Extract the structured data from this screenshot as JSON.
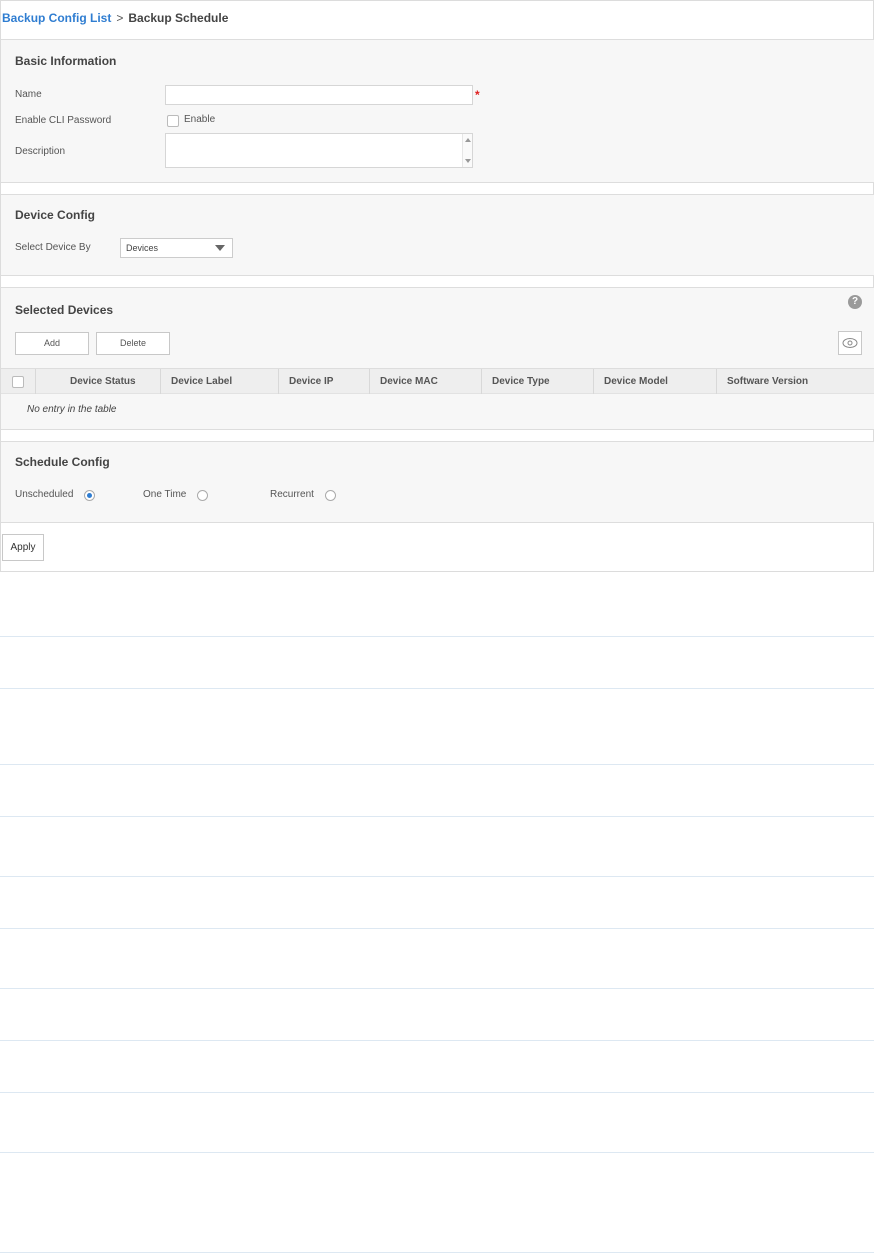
{
  "breadcrumb": {
    "link": "Backup Config List",
    "separator": ">",
    "current": "Backup Schedule"
  },
  "basic_info": {
    "title": "Basic Information",
    "name_label": "Name",
    "name_value": "",
    "required_mark": "*",
    "cli_password_label": "Enable CLI Password",
    "enable_label": "Enable",
    "description_label": "Description",
    "description_value": ""
  },
  "device_config": {
    "title": "Device Config",
    "select_by_label": "Select Device By",
    "select_by_value": "Devices"
  },
  "selected_devices": {
    "title": "Selected Devices",
    "help": "?",
    "add_label": "Add",
    "delete_label": "Delete",
    "columns": [
      "Device Status",
      "Device Label",
      "Device IP",
      "Device MAC",
      "Device Type",
      "Device Model",
      "Software Version"
    ],
    "rows": [],
    "empty_message": "No entry in the table"
  },
  "schedule_config": {
    "title": "Schedule Config",
    "options": [
      {
        "label": "Unscheduled",
        "selected": true
      },
      {
        "label": "One Time",
        "selected": false
      },
      {
        "label": "Recurrent",
        "selected": false
      }
    ]
  },
  "apply_label": "Apply",
  "colors": {
    "accent": "#2f7dd1",
    "required": "#e02020",
    "section_bg": "#f7f7f7"
  }
}
